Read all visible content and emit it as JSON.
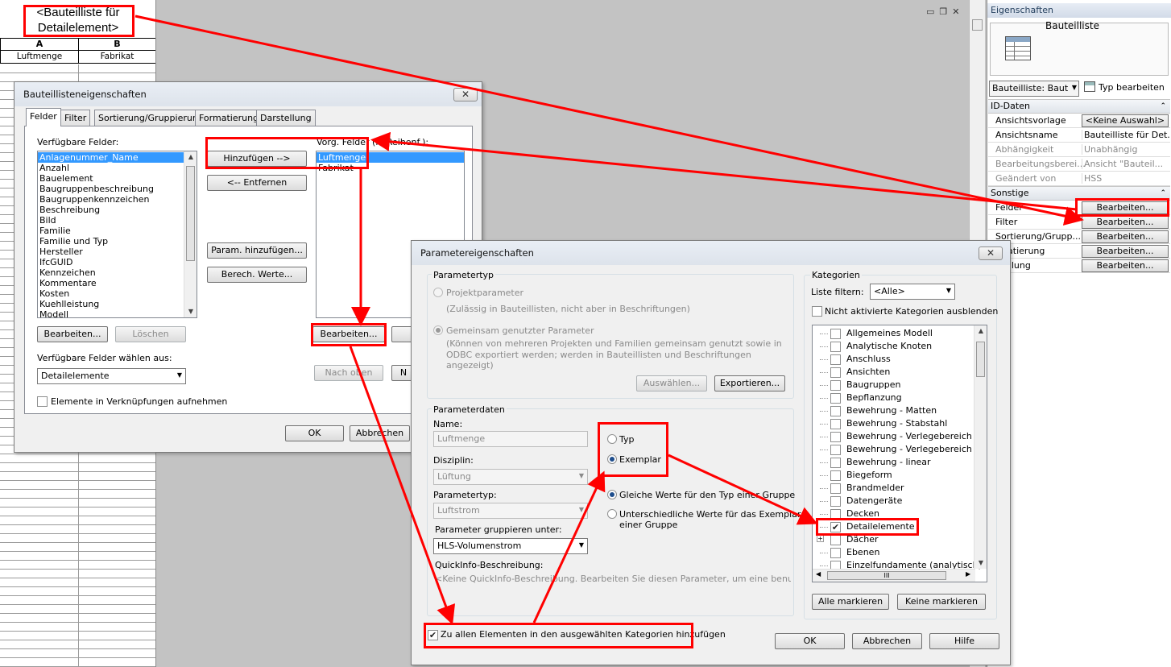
{
  "sheet": {
    "title": "<Bauteilliste für Detailelement>",
    "col_a": "A",
    "col_b": "B",
    "cell_a": "Luftmenge",
    "cell_b": "Fabrikat"
  },
  "properties": {
    "title": "Eigenschaften",
    "type_label": "Bauteilliste",
    "type_dropdown": "Bauteilliste: Baut",
    "edit_type": "Typ bearbeiten",
    "section_id": "ID-Daten",
    "section_other": "Sonstige",
    "rows": [
      {
        "key": "Ansichtsvorlage",
        "value": "<Keine Auswahl>"
      },
      {
        "key": "Ansichtsname",
        "value": "Bauteilliste für Det..."
      },
      {
        "key": "Abhängigkeit",
        "value": "Unabhängig"
      },
      {
        "key": "Bearbeitungsberei...",
        "value": "Ansicht \"Bauteil..."
      },
      {
        "key": "Geändert von",
        "value": "HSS"
      }
    ],
    "other_rows": [
      {
        "key": "Felder",
        "button": "Bearbeiten..."
      },
      {
        "key": "Filter",
        "button": "Bearbeiten..."
      },
      {
        "key": "Sortierung/Grupp...",
        "button": "Bearbeiten..."
      },
      {
        "key": "rmatierung",
        "button": "Bearbeiten..."
      },
      {
        "key": "stellung",
        "button": "Bearbeiten..."
      }
    ]
  },
  "dialog1": {
    "title": "Bauteillisteneigenschaften",
    "close": "✕",
    "tabs": [
      "Felder",
      "Filter",
      "Sortierung/Gruppierung",
      "Formatierung",
      "Darstellung"
    ],
    "available_label": "Verfügbare Felder:",
    "available_fields": [
      "Anlagenummer_Name",
      "Anzahl",
      "Bauelement",
      "Baugruppenbeschreibung",
      "Baugruppenkennzeichen",
      "Beschreibung",
      "Bild",
      "Familie",
      "Familie und Typ",
      "Hersteller",
      "IfcGUID",
      "Kennzeichen",
      "Kommentare",
      "Kosten",
      "Kuehlleistung",
      "Modell"
    ],
    "add_button": "Hinzufügen -->",
    "remove_button": "<-- Entfernen",
    "param_add_button": "Param. hinzufügen...",
    "calc_button": "Berech. Werte...",
    "selected_label": "Vorg. Felder (in Reihenf.):",
    "selected_fields": [
      "Luftmenge",
      "Fabrikat"
    ],
    "edit_left": "Bearbeiten...",
    "delete_left": "Löschen",
    "edit_right": "Bearbeiten...",
    "choose_label": "Verfügbare Felder wählen aus:",
    "choose_value": "Detailelemente",
    "move_up": "Nach oben",
    "move_down": "N",
    "include_links": "Elemente in Verknüpfungen aufnehmen",
    "ok": "OK",
    "cancel": "Abbrechen"
  },
  "dialog2": {
    "title": "Parametereigenschaften",
    "close": "✕",
    "paramtype_group": "Parametertyp",
    "project_param": "Projektparameter",
    "project_param_hint": "(Zulässig in Bauteillisten, nicht aber in Beschriftungen)",
    "shared_param": "Gemeinsam genutzter Parameter",
    "shared_param_hint": [
      "(Können von mehreren Projekten und Familien gemeinsam genutzt sowie in",
      "ODBC exportiert werden; werden in Bauteillisten und Beschriftungen",
      "angezeigt)"
    ],
    "select_button": "Auswählen...",
    "export_button": "Exportieren...",
    "paramdata_group": "Parameterdaten",
    "name_label": "Name:",
    "name_value": "Luftmenge",
    "discipline_label": "Disziplin:",
    "discipline_value": "Lüftung",
    "paramtype_label": "Parametertyp:",
    "paramtype_value": "Luftstrom",
    "group_label": "Parameter gruppieren unter:",
    "group_value": "HLS-Volumenstrom",
    "type_radio": "Typ",
    "instance_radio": "Exemplar",
    "same_values": "Gleiche Werte für den Typ einer Gruppe",
    "diff_values": [
      "Unterschiedliche Werte für das Exemplar",
      "einer Gruppe"
    ],
    "quickinfo_label": "QuickInfo-Beschreibung:",
    "quickinfo_value": "<Keine QuickInfo-Beschreibung. Bearbeiten Sie diesen Parameter, um eine benutzerdefini...",
    "add_all": "Zu allen Elementen in den ausgewählten Kategorien hinzufügen",
    "categories_group": "Kategorien",
    "filter_label": "Liste filtern:",
    "filter_value": "<Alle>",
    "hide_unchecked": "Nicht aktivierte Kategorien ausblenden",
    "categories": [
      {
        "name": "Allgemeines Modell",
        "checked": false
      },
      {
        "name": "Analytische Knoten",
        "checked": false
      },
      {
        "name": "Anschluss",
        "checked": false
      },
      {
        "name": "Ansichten",
        "checked": false
      },
      {
        "name": "Baugruppen",
        "checked": false
      },
      {
        "name": "Bepflanzung",
        "checked": false
      },
      {
        "name": "Bewehrung - Matten",
        "checked": false
      },
      {
        "name": "Bewehrung - Stabstahl",
        "checked": false
      },
      {
        "name": "Bewehrung - Verlegebereich Flä...",
        "checked": false
      },
      {
        "name": "Bewehrung - Verlegebereich Mat...",
        "checked": false
      },
      {
        "name": "Bewehrung - linear",
        "checked": false
      },
      {
        "name": "Biegeform",
        "checked": false
      },
      {
        "name": "Brandmelder",
        "checked": false
      },
      {
        "name": "Datengeräte",
        "checked": false
      },
      {
        "name": "Decken",
        "checked": false
      },
      {
        "name": "Detailelemente",
        "checked": true
      },
      {
        "name": "Dächer",
        "checked": false
      },
      {
        "name": "Ebenen",
        "checked": false
      },
      {
        "name": "Einzelfundamente (analytisch)",
        "checked": false
      }
    ],
    "hscroll_grip": "III",
    "mark_all": "Alle markieren",
    "mark_none": "Keine markieren",
    "ok": "OK",
    "cancel": "Abbrechen",
    "help": "Hilfe"
  },
  "colors": {
    "annotation_red": "#ff0000",
    "selection_blue": "#3399ff",
    "dialog_bg": "#f0f0f0",
    "canvas_gray": "#c3c3c3"
  }
}
